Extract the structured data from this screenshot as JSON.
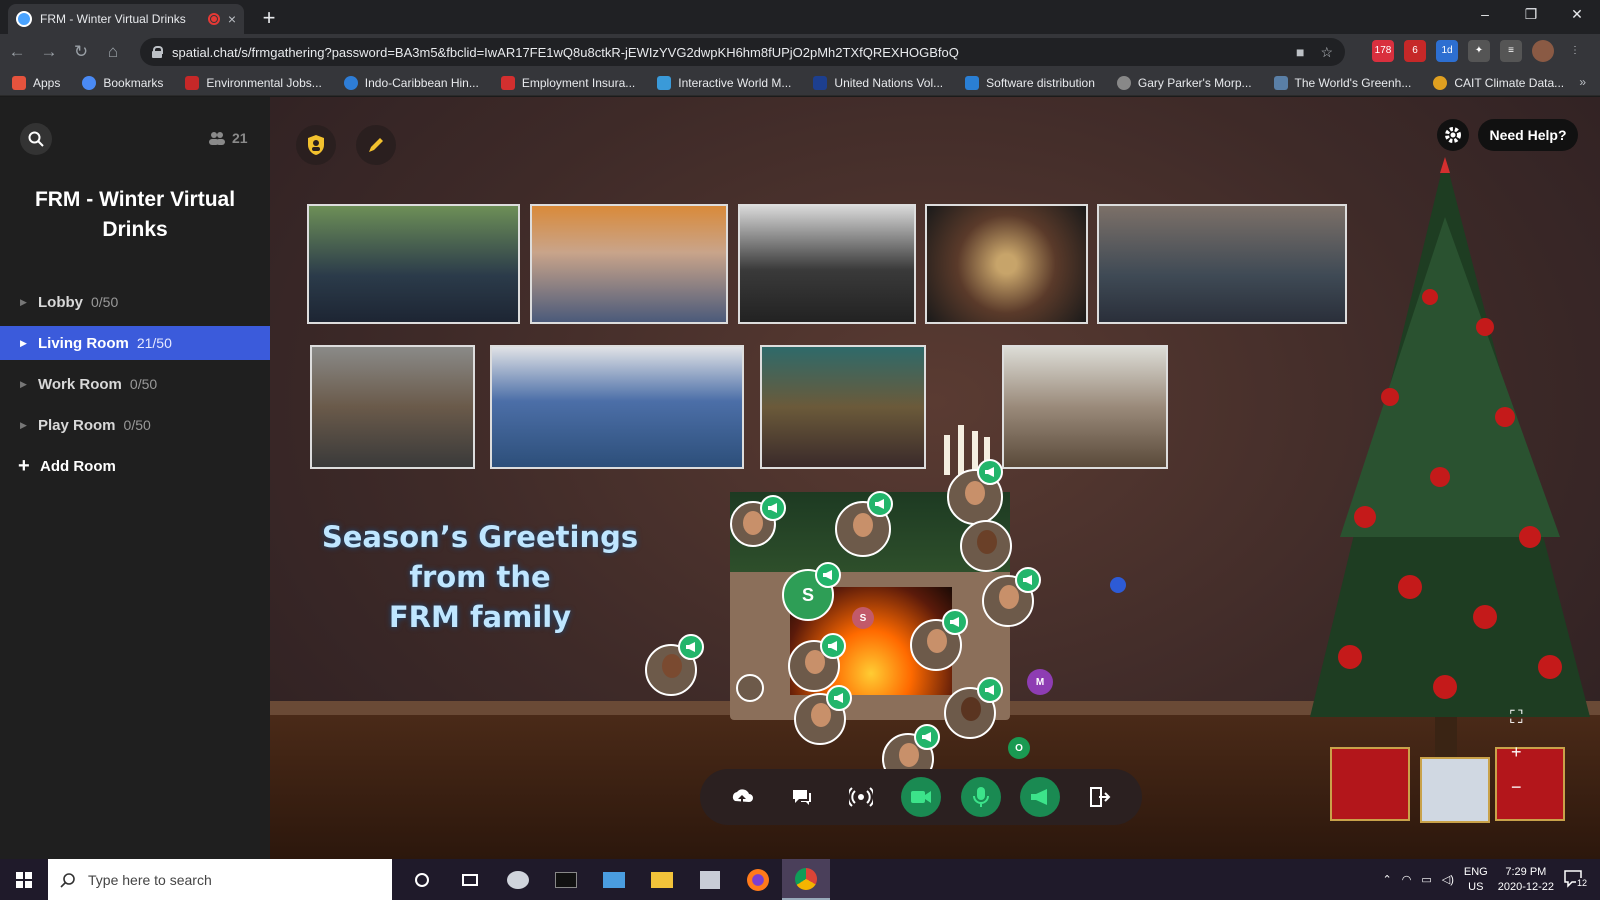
{
  "browser": {
    "tab_title": "FRM - Winter Virtual Drinks",
    "tab_close": "×",
    "new_tab": "+",
    "url": "spatial.chat/s/frmgathering?password=BA3m5&fbclid=IwAR17FE1wQ8u8ctkR-jEWIzYVG2dwpKH6hm8fUPjO2pMh2TXfQREXHOGBfoQ",
    "window_controls": [
      "–",
      "❐",
      "✕"
    ],
    "ext_badges": [
      "178",
      "6",
      "1d"
    ]
  },
  "bookmarks": [
    {
      "label": "Apps",
      "color": "#e5533d"
    },
    {
      "label": "Bookmarks",
      "color": "#4a8af4"
    },
    {
      "label": "Environmental Jobs...",
      "color": "#c62828"
    },
    {
      "label": "Indo-Caribbean Hin...",
      "color": "#2e7dd6"
    },
    {
      "label": "Employment Insura...",
      "color": "#d32f2f"
    },
    {
      "label": "Interactive World M...",
      "color": "#3a9ad9"
    },
    {
      "label": "United Nations Vol...",
      "color": "#1d3f8f"
    },
    {
      "label": "Software distribution",
      "color": "#2a7fd4"
    },
    {
      "label": "Gary Parker's Morp...",
      "color": "#888888"
    },
    {
      "label": "The World's Greenh...",
      "color": "#5a7fa6"
    },
    {
      "label": "CAIT Climate Data...",
      "color": "#e0a020"
    }
  ],
  "bookmarks_more": "»",
  "sidebar": {
    "participant_count": "21",
    "title": "FRM - Winter Virtual Drinks",
    "rooms": [
      {
        "name": "Lobby",
        "count": "0/50",
        "active": false
      },
      {
        "name": "Living Room",
        "count": "21/50",
        "active": true
      },
      {
        "name": "Work Room",
        "count": "0/50",
        "active": false
      },
      {
        "name": "Play Room",
        "count": "0/50",
        "active": false
      }
    ],
    "add_room": "Add Room"
  },
  "canvas": {
    "need_help": "Need Help?",
    "greeting": [
      "Season’s Greetings",
      "from the",
      "FRM family"
    ],
    "letter_avatars": [
      "S",
      "S",
      "M",
      "O"
    ]
  },
  "taskbar": {
    "search_placeholder": "Type here to search",
    "lang_top": "ENG",
    "lang_bottom": "US",
    "time": "7:29 PM",
    "date": "2020-12-22",
    "notif_count": "12"
  },
  "colors": {
    "active_room": "#3b5bdb",
    "speaking_green": "#22b56b",
    "mic_green": "#1a8a52"
  }
}
